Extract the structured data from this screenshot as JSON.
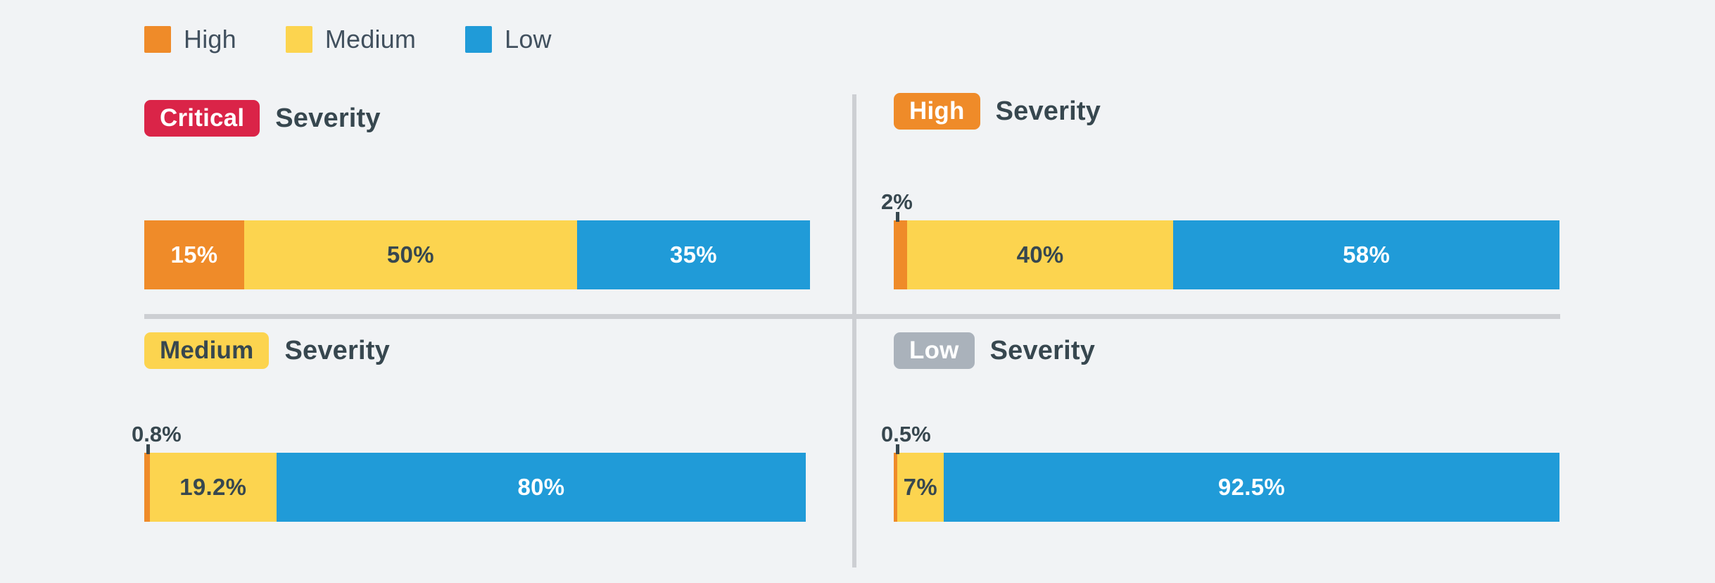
{
  "colors": {
    "background": "#f1f3f5",
    "high": "#ef8b29",
    "medium": "#fcd44f",
    "low": "#209bd8",
    "critical_badge": "#da2448",
    "low_badge": "#aab2bb",
    "text_dark": "#37474f",
    "text_light": "#ffffff",
    "divider": "#cdcfd3"
  },
  "legend": {
    "items": [
      {
        "label": "High",
        "color": "#ef8b29",
        "swatch_name": "legend-swatch-high"
      },
      {
        "label": "Medium",
        "color": "#fcd44f",
        "swatch_name": "legend-swatch-medium"
      },
      {
        "label": "Low",
        "color": "#209bd8",
        "swatch_name": "legend-swatch-low"
      }
    ]
  },
  "panels": [
    {
      "badge": "Critical",
      "suffix": "Severity",
      "badge_bg": "#da2448",
      "badge_fg": "#ffffff",
      "callout": null,
      "segments": [
        {
          "label": "15%",
          "value": 15,
          "series": "High",
          "color": "#ef8b29",
          "text_color": "#ffffff"
        },
        {
          "label": "50%",
          "value": 50,
          "series": "Medium",
          "color": "#fcd44f",
          "text_color": "#37474f"
        },
        {
          "label": "35%",
          "value": 35,
          "series": "Low",
          "color": "#209bd8",
          "text_color": "#ffffff"
        }
      ]
    },
    {
      "badge": "High",
      "suffix": "Severity",
      "badge_bg": "#ef8b29",
      "badge_fg": "#ffffff",
      "callout": "2%",
      "segments": [
        {
          "label": "2%",
          "value": 2,
          "series": "High",
          "color": "#ef8b29",
          "text_color": "#ffffff",
          "hide_label": true
        },
        {
          "label": "40%",
          "value": 40,
          "series": "Medium",
          "color": "#fcd44f",
          "text_color": "#37474f"
        },
        {
          "label": "58%",
          "value": 58,
          "series": "Low",
          "color": "#209bd8",
          "text_color": "#ffffff"
        }
      ]
    },
    {
      "badge": "Medium",
      "suffix": "Severity",
      "badge_bg": "#fcd44f",
      "badge_fg": "#37474f",
      "callout": "0.8%",
      "segments": [
        {
          "label": "0.8%",
          "value": 0.8,
          "series": "High",
          "color": "#ef8b29",
          "text_color": "#ffffff",
          "hide_label": true
        },
        {
          "label": "19.2%",
          "value": 19.2,
          "series": "Medium",
          "color": "#fcd44f",
          "text_color": "#37474f"
        },
        {
          "label": "80%",
          "value": 80,
          "series": "Low",
          "color": "#209bd8",
          "text_color": "#ffffff"
        }
      ]
    },
    {
      "badge": "Low",
      "suffix": "Severity",
      "badge_bg": "#aab2bb",
      "badge_fg": "#ffffff",
      "callout": "0.5%",
      "segments": [
        {
          "label": "0.5%",
          "value": 0.5,
          "series": "High",
          "color": "#ef8b29",
          "text_color": "#ffffff",
          "hide_label": true
        },
        {
          "label": "7%",
          "value": 7,
          "series": "Medium",
          "color": "#fcd44f",
          "text_color": "#37474f"
        },
        {
          "label": "92.5%",
          "value": 92.5,
          "series": "Low",
          "color": "#209bd8",
          "text_color": "#ffffff"
        }
      ]
    }
  ],
  "chart_data": {
    "type": "bar",
    "title": "",
    "xlabel": "",
    "ylabel": "",
    "orientation": "horizontal",
    "stacked": true,
    "normalized": true,
    "xlim": [
      0,
      100
    ],
    "grid": false,
    "legend_position": "top-left",
    "categories": [
      "Critical Severity",
      "High Severity",
      "Medium Severity",
      "Low Severity"
    ],
    "series": [
      {
        "name": "High",
        "color": "#ef8b29",
        "values": [
          15,
          2,
          0.8,
          0.5
        ]
      },
      {
        "name": "Medium",
        "color": "#fcd44f",
        "values": [
          50,
          40,
          19.2,
          7
        ]
      },
      {
        "name": "Low",
        "color": "#209bd8",
        "values": [
          35,
          58,
          80,
          92.5
        ]
      }
    ],
    "data_labels": [
      [
        "15%",
        "50%",
        "35%"
      ],
      [
        "2%",
        "40%",
        "58%"
      ],
      [
        "0.8%",
        "19.2%",
        "80%"
      ],
      [
        "0.5%",
        "7%",
        "92.5%"
      ]
    ]
  }
}
